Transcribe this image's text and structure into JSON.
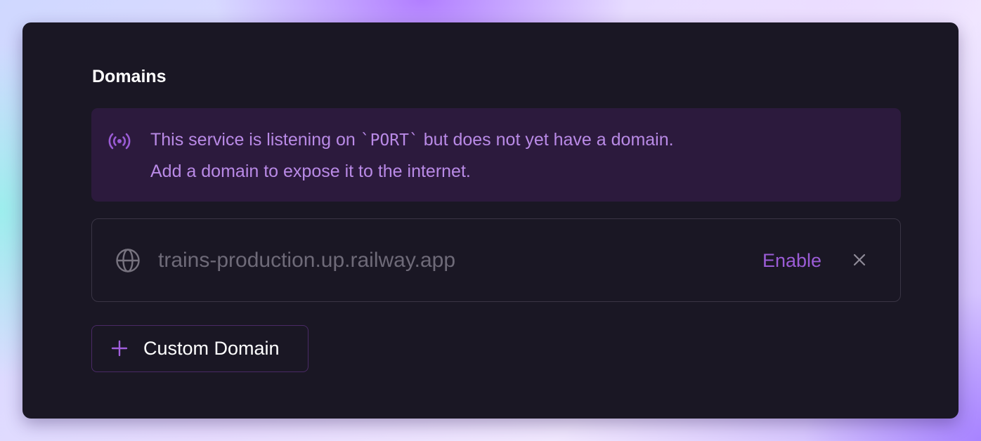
{
  "section": {
    "title": "Domains"
  },
  "notice": {
    "line1_prefix": "This service is listening on ",
    "line1_code": "`PORT`",
    "line1_suffix": " but does not yet have a domain.",
    "line2": "Add a domain to expose it to the internet.",
    "icon": "broadcast-icon"
  },
  "domain_row": {
    "icon": "globe-icon",
    "domain": "trains-production.up.railway.app",
    "enable_label": "Enable",
    "dismiss_icon": "close-icon"
  },
  "custom_domain": {
    "icon": "plus-icon",
    "label": "Custom Domain"
  },
  "colors": {
    "card_background": "#1a1724",
    "notice_background": "#2c1a3d",
    "notice_text": "#b98ae6",
    "accent": "#9b5cd6",
    "muted_text": "#6e6a78",
    "border": "#3a3545"
  }
}
